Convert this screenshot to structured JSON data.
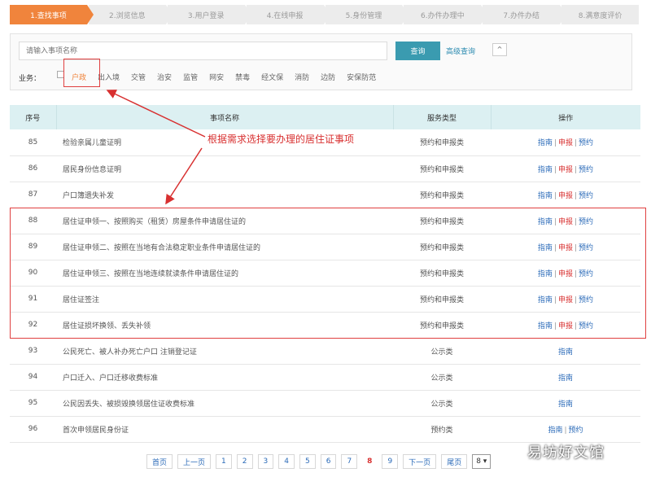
{
  "steps": [
    {
      "label": "1.查找事项",
      "active": true
    },
    {
      "label": "2.浏览信息",
      "active": false
    },
    {
      "label": "3.用户登录",
      "active": false
    },
    {
      "label": "4.在线申报",
      "active": false
    },
    {
      "label": "5.身份管理",
      "active": false
    },
    {
      "label": "6.办件办理中",
      "active": false
    },
    {
      "label": "7.办件办结",
      "active": false
    },
    {
      "label": "8.满意度评价",
      "active": false
    }
  ],
  "search": {
    "placeholder": "请输入事项名称",
    "button_label": "查询",
    "advanced_label": "高级查询",
    "collapse_icon": "^"
  },
  "business": {
    "label": "业务：",
    "categories": [
      "户政",
      "出入境",
      "交管",
      "治安",
      "监管",
      "网安",
      "禁毒",
      "经文保",
      "消防",
      "边防",
      "安保防范"
    ],
    "selected": "户政"
  },
  "annotation": {
    "text": "根据需求选择要办理的居住证事项"
  },
  "table": {
    "headers": [
      "序号",
      "事项名称",
      "服务类型",
      "操作"
    ],
    "rows": [
      {
        "num": "85",
        "name": "检验亲属儿童证明",
        "type": "预约和申报类",
        "ops": [
          "指南",
          "申报",
          "预约"
        ]
      },
      {
        "num": "86",
        "name": "居民身份信息证明",
        "type": "预约和申报类",
        "ops": [
          "指南",
          "申报",
          "预约"
        ]
      },
      {
        "num": "87",
        "name": "户口簿遗失补发",
        "type": "预约和申报类",
        "ops": [
          "指南",
          "申报",
          "预约"
        ]
      },
      {
        "num": "88",
        "name": "居住证申领一、按照购买（租赁）房屋条件申请居住证的",
        "type": "预约和申报类",
        "ops": [
          "指南",
          "申报",
          "预约"
        ]
      },
      {
        "num": "89",
        "name": "居住证申领二、按照在当地有合法稳定职业条件申请居住证的",
        "type": "预约和申报类",
        "ops": [
          "指南",
          "申报",
          "预约"
        ]
      },
      {
        "num": "90",
        "name": "居住证申领三、按照在当地连续就读条件申请居住证的",
        "type": "预约和申报类",
        "ops": [
          "指南",
          "申报",
          "预约"
        ]
      },
      {
        "num": "91",
        "name": "居住证签注",
        "type": "预约和申报类",
        "ops": [
          "指南",
          "申报",
          "预约"
        ]
      },
      {
        "num": "92",
        "name": "居住证损坏换领、丢失补领",
        "type": "预约和申报类",
        "ops": [
          "指南",
          "申报",
          "预约"
        ]
      },
      {
        "num": "93",
        "name": "公民死亡、被人补办死亡户口 注销登记证",
        "type": "公示类",
        "ops": [
          "指南"
        ]
      },
      {
        "num": "94",
        "name": "户口迁入、户口迁移收费标准",
        "type": "公示类",
        "ops": [
          "指南"
        ]
      },
      {
        "num": "95",
        "name": "公民因丢失、被损毁换领居住证收费标准",
        "type": "公示类",
        "ops": [
          "指南"
        ]
      },
      {
        "num": "96",
        "name": "首次申领居民身份证",
        "type": "预约类",
        "ops": [
          "指南",
          "预约"
        ]
      }
    ]
  },
  "pager": {
    "first": "首页",
    "prev": "上一页",
    "pages": [
      "1",
      "2",
      "3",
      "4",
      "5",
      "6",
      "7",
      "8",
      "9"
    ],
    "current": "8",
    "next": "下一页",
    "last": "尾页",
    "select_value": "8 ▾"
  },
  "watermark": "易坊好文馆",
  "colors": {
    "accent": "#f0843c",
    "primary_button": "#3a9bb0",
    "table_header": "#dcf0f2",
    "highlight": "#e04040",
    "link": "#2a6ab8"
  }
}
